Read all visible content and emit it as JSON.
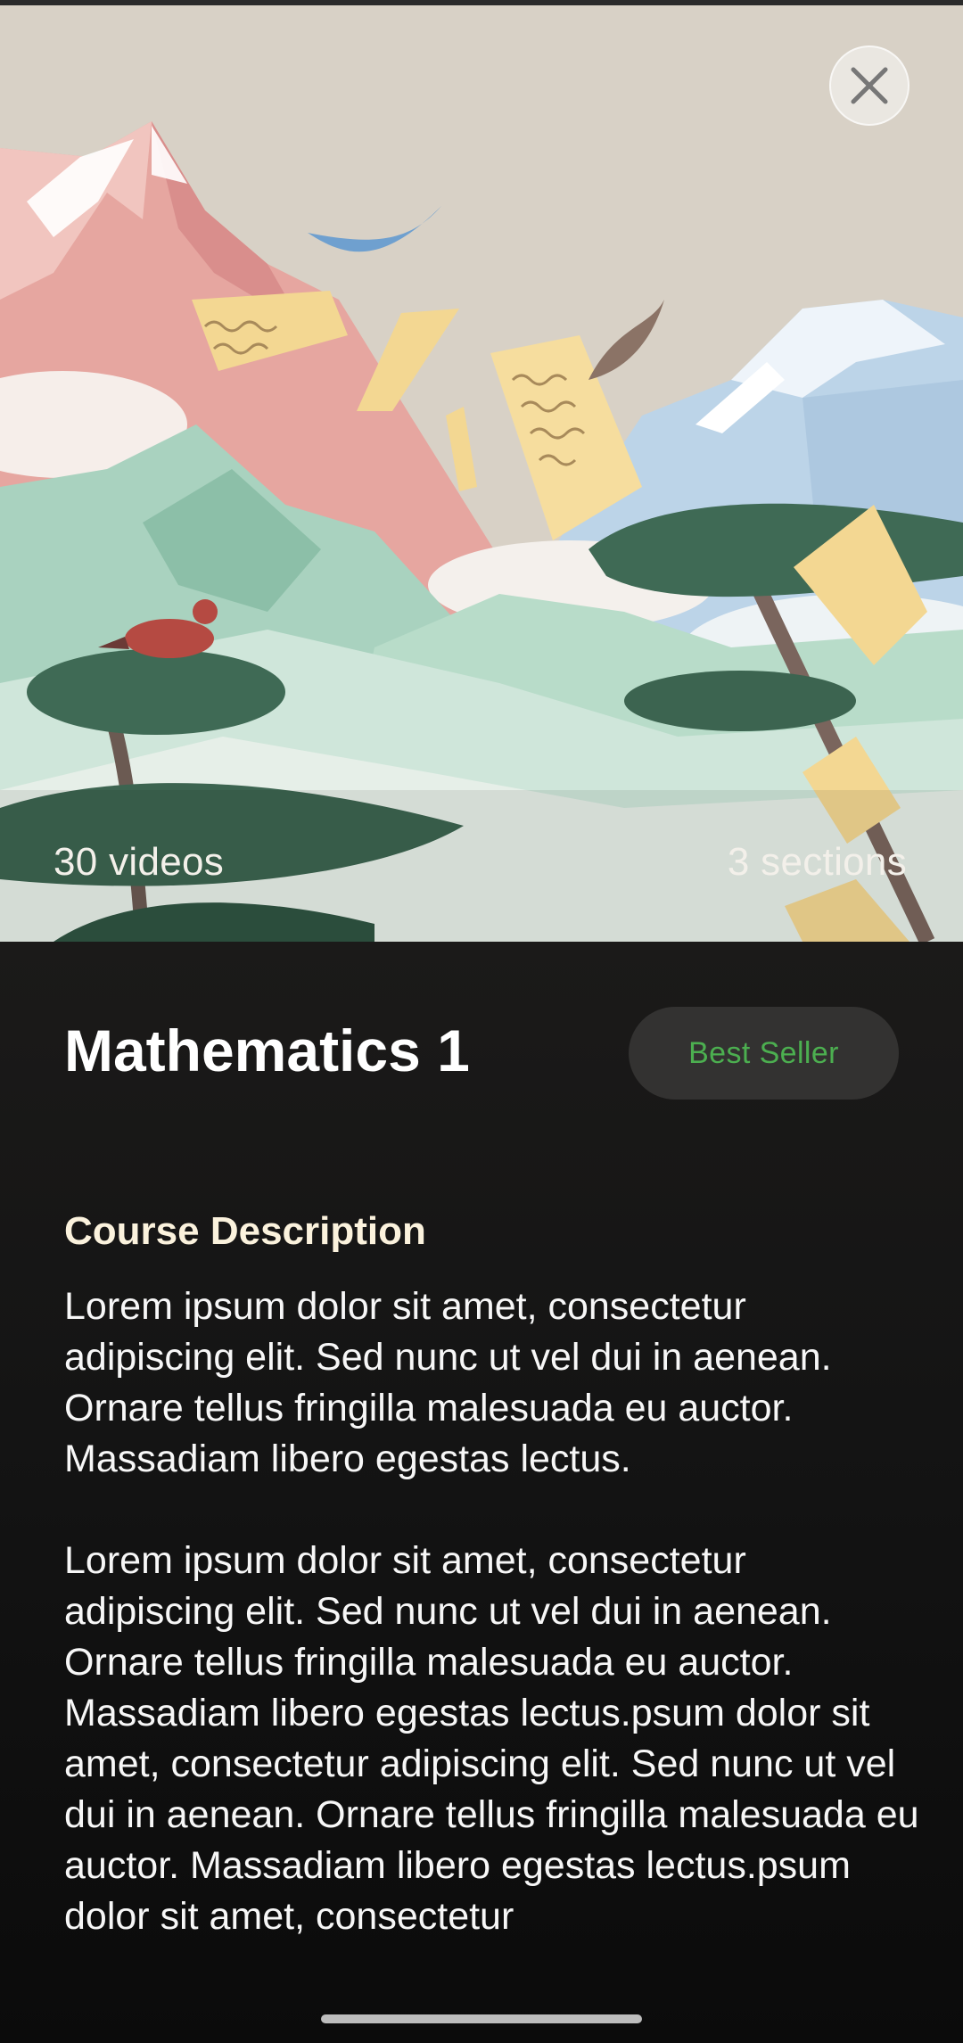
{
  "hero": {
    "videos_label": "30 videos",
    "sections_label": "3 sections",
    "illustration_icon": "mountain-landscape-illustration",
    "close_icon": "close-icon"
  },
  "course": {
    "title": "Mathematics 1",
    "badge": "Best Seller"
  },
  "description": {
    "heading": "Course Description",
    "paragraph_1": "Lorem ipsum dolor sit amet, consectetur adipiscing elit. Sed nunc ut vel dui in aenean. Ornare tellus fringilla malesuada eu auctor. Massadiam libero egestas lectus.",
    "paragraph_2": "Lorem ipsum dolor sit amet, consectetur adipiscing elit. Sed nunc ut vel dui in aenean. Ornare tellus fringilla malesuada eu auctor. Massadiam libero egestas lectus.psum dolor sit amet, consectetur adipiscing elit. Sed nunc ut vel dui in aenean. Ornare tellus fringilla malesuada eu auctor. Massadiam libero egestas lectus.psum dolor sit amet, consectetur"
  },
  "colors": {
    "background": "#171717",
    "badge_background": "#333231",
    "badge_text": "#4caf50",
    "heading_text": "#fbf2dd"
  }
}
